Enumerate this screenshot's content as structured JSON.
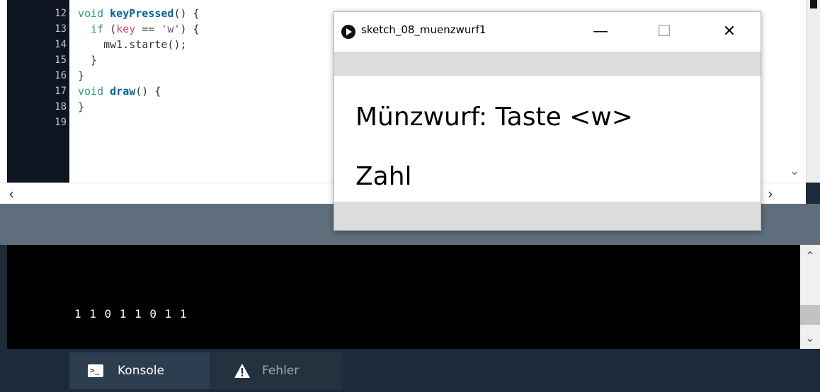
{
  "editor": {
    "lines": [
      {
        "num": "12",
        "segments": [
          {
            "cls": "kw",
            "t": "void "
          },
          {
            "cls": "fn",
            "t": "keyPressed"
          },
          {
            "cls": "tx",
            "t": "() {"
          }
        ]
      },
      {
        "num": "13",
        "segments": [
          {
            "cls": "tx",
            "t": "  "
          },
          {
            "cls": "kw",
            "t": "if"
          },
          {
            "cls": "tx",
            "t": " ("
          },
          {
            "cls": "var",
            "t": "key"
          },
          {
            "cls": "tx",
            "t": " == "
          },
          {
            "cls": "str",
            "t": "'w'"
          },
          {
            "cls": "tx",
            "t": ") {"
          }
        ]
      },
      {
        "num": "14",
        "segments": [
          {
            "cls": "tx",
            "t": "    mw1.starte();"
          }
        ]
      },
      {
        "num": "15",
        "segments": [
          {
            "cls": "tx",
            "t": "  }"
          }
        ]
      },
      {
        "num": "16",
        "segments": [
          {
            "cls": "tx",
            "t": "}"
          }
        ]
      },
      {
        "num": "17",
        "segments": [
          {
            "cls": "kw",
            "t": "void "
          },
          {
            "cls": "fn",
            "t": "draw"
          },
          {
            "cls": "tx",
            "t": "() {"
          }
        ]
      },
      {
        "num": "18",
        "segments": [
          {
            "cls": "tx",
            "t": "}"
          }
        ]
      },
      {
        "num": "19",
        "segments": []
      }
    ],
    "icons": {
      "scroll_left": "chevron-left-icon",
      "scroll_right": "chevron-right-icon",
      "scroll_down": "chevron-down-icon"
    }
  },
  "console": {
    "output": "1 1 0 1 1 0 1 1"
  },
  "tabs": {
    "console_label": "Konsole",
    "errors_label": "Fehler"
  },
  "sketch_window": {
    "title": "sketch_08_muenzwurf1",
    "line1": "Münzwurf: Taste <w>",
    "line2": "Zahl"
  },
  "colors": {
    "keyword": "#33997e",
    "function": "#006699",
    "string": "#7d4793",
    "variable": "#d94a7a",
    "gutter": "#0e1520",
    "footer": "#1c2a3a"
  }
}
